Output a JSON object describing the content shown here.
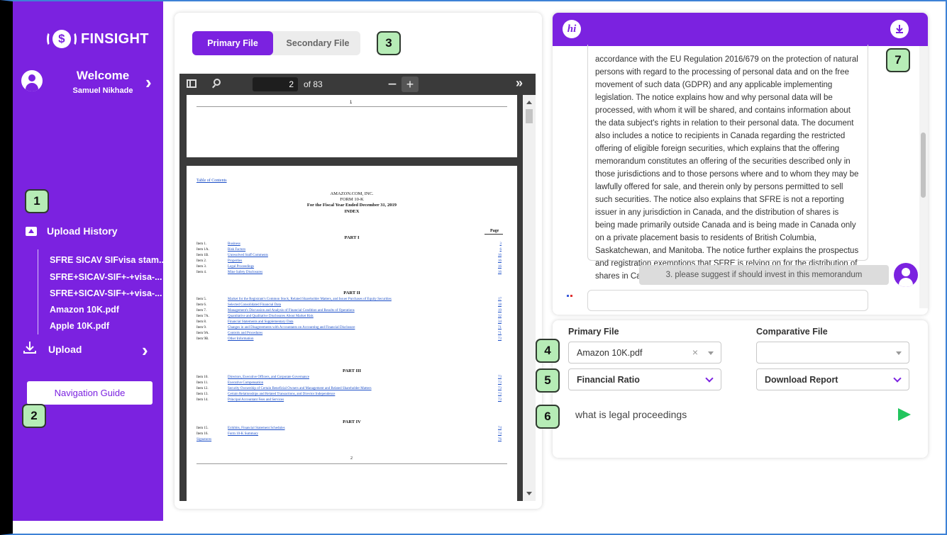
{
  "brand": {
    "name": "FINSIGHT"
  },
  "user": {
    "welcome": "Welcome",
    "name": "Samuel Nikhade"
  },
  "sidebar": {
    "upload_history_label": "Upload History",
    "history_items": [
      "SFRE SICAV SIFvisa stam...",
      "SFRE+SICAV-SIF+-+visa-...",
      "SFRE+SICAV-SIF+-+visa-...",
      "Amazon 10K.pdf",
      "Apple 10K.pdf"
    ],
    "upload_label": "Upload",
    "nav_guide_label": "Navigation Guide"
  },
  "annotations": [
    "1",
    "2",
    "3",
    "4",
    "5",
    "6",
    "7"
  ],
  "file_tabs": {
    "primary": "Primary File",
    "secondary": "Secondary File"
  },
  "viewer": {
    "page_current": "2",
    "page_total": "of 83",
    "page1_number": "1",
    "page2_number": "2",
    "toc_link": "Table of Contents",
    "company": "AMAZON.COM, INC.",
    "form": "FORM 10-K",
    "period": "For the Fiscal Year Ended December 31, 2019",
    "index": "INDEX",
    "page_col": "Page",
    "parts": [
      {
        "title": "PART I",
        "rows": [
          {
            "item": "Item 1.",
            "title": "Business",
            "page": "3"
          },
          {
            "item": "Item 1A.",
            "title": "Risk Factors",
            "page": "6"
          },
          {
            "item": "Item 1B.",
            "title": "Unresolved Staff Comments",
            "page": "16"
          },
          {
            "item": "Item 2.",
            "title": "Properties",
            "page": "16"
          },
          {
            "item": "Item 3.",
            "title": "Legal Proceedings",
            "page": "16"
          },
          {
            "item": "Item 4.",
            "title": "Mine Safety Disclosures",
            "page": "16"
          }
        ]
      },
      {
        "title": "PART II",
        "rows": [
          {
            "item": "Item 5.",
            "title": "Market for the Registrant's Common Stock, Related Shareholder Matters, and Issuer Purchases of Equity Securities",
            "page": "17"
          },
          {
            "item": "Item 6.",
            "title": "Selected Consolidated Financial Data",
            "page": "18"
          },
          {
            "item": "Item 7.",
            "title": "Management's Discussion and Analysis of Financial Condition and Results of Operations",
            "page": "19"
          },
          {
            "item": "Item 7A.",
            "title": "Quantitative and Qualitative Disclosures About Market Risk",
            "page": "32"
          },
          {
            "item": "Item 8.",
            "title": "Financial Statements and Supplementary Data",
            "page": "34"
          },
          {
            "item": "Item 9.",
            "title": "Changes in and Disagreements with Accountants on Accounting and Financial Disclosure",
            "page": "71"
          },
          {
            "item": "Item 9A.",
            "title": "Controls and Procedures",
            "page": "71"
          },
          {
            "item": "Item 9B.",
            "title": "Other Information",
            "page": "73"
          }
        ]
      },
      {
        "title": "PART III",
        "rows": [
          {
            "item": "Item 10.",
            "title": "Directors, Executive Officers, and Corporate Governance",
            "page": "73"
          },
          {
            "item": "Item 11.",
            "title": "Executive Compensation",
            "page": "73"
          },
          {
            "item": "Item 12.",
            "title": "Security Ownership of Certain Beneficial Owners and Management and Related Shareholder Matters",
            "page": "73"
          },
          {
            "item": "Item 13.",
            "title": "Certain Relationships and Related Transactions, and Director Independence",
            "page": "73"
          },
          {
            "item": "Item 14.",
            "title": "Principal Accountant Fees and Services",
            "page": "73"
          }
        ]
      },
      {
        "title": "PART IV",
        "rows": [
          {
            "item": "Item 15.",
            "title": "Exhibits, Financial Statement Schedules",
            "page": "74"
          },
          {
            "item": "Item 16.",
            "title": "Form 10-K Summary",
            "page": "74"
          },
          {
            "item": "",
            "title": "Signatures",
            "page": "76"
          }
        ]
      }
    ]
  },
  "chat": {
    "bot_message": "accordance with the EU Regulation 2016/679 on the protection of natural persons with regard to the processing of personal data and on the free movement of such data (GDPR) and any applicable implementing legislation. The notice explains how and why personal data will be processed, with whom it will be shared, and contains information about the data subject's rights in relation to their personal data. The document also includes a notice to recipients in Canada regarding the restricted offering of eligible foreign securities, which explains that the offering memorandum constitutes an offering of the securities described only in those jurisdictions and to those persons where and to whom they may be lawfully offered for sale, and therein only by persons permitted to sell such securities. The notice also explains that SFRE is not a reporting issuer in any jurisdiction in Canada, and the distribution of shares is being made primarily outside Canada and is being made in Canada only on a private placement basis to residents of British Columbia, Saskatchewan, and Manitoba. The notice further explains the prospectus and registration exemptions that SFRE is relying on for the distribution of shares in Canada.\"}",
    "user_message": "3. please suggest if should invest in this memorandum",
    "logo_text": "hi"
  },
  "controls": {
    "primary_label": "Primary File",
    "comparative_label": "Comparative File",
    "primary_value": "Amazon 10K.pdf",
    "comparative_value": "",
    "analysis_value": "Financial Ratio",
    "report_value": "Download Report",
    "query_value": "what is legal proceedings"
  },
  "colors": {
    "accent": "#7b22e0",
    "badge": "#b6ecb6",
    "send": "#22c55e"
  }
}
